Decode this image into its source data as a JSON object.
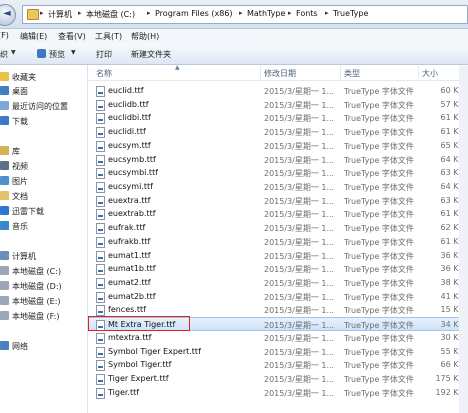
{
  "address_bar": {
    "back_glyph": "◄",
    "crumbs": [
      "计算机",
      "本地磁盘 (C:)",
      "Program Files (x86)",
      "MathType",
      "Fonts",
      "TrueType"
    ],
    "separator": "▸"
  },
  "menubar": {
    "items": [
      "(F)",
      "编辑(E)",
      "查看(V)",
      "工具(T)",
      "帮助(H)"
    ]
  },
  "commandbar": {
    "items": [
      "织",
      "预览",
      "打印",
      "新建文件夹"
    ]
  },
  "nav": {
    "items": [
      {
        "label": "收藏夹",
        "color": "#e9c24a"
      },
      {
        "label": "桌面",
        "color": "#3f7fc6"
      },
      {
        "label": "最近访问的位置",
        "color": "#7da7d6"
      },
      {
        "label": "下载",
        "color": "#3a7ac8"
      },
      {
        "label": "库",
        "color": "#d9b054"
      },
      {
        "label": "视频",
        "color": "#5f6f88"
      },
      {
        "label": "图片",
        "color": "#4e8fcf"
      },
      {
        "label": "文档",
        "color": "#e1c26a"
      },
      {
        "label": "迅雷下载",
        "color": "#2f76d1"
      },
      {
        "label": "音乐",
        "color": "#3a88c9"
      },
      {
        "label": "计算机",
        "color": "#6a8fb8"
      },
      {
        "label": "本地磁盘 (C:)",
        "color": "#9aa7b6"
      },
      {
        "label": "本地磁盘 (D:)",
        "color": "#9aa7b6"
      },
      {
        "label": "本地磁盘 (E:)",
        "color": "#9aa7b6"
      },
      {
        "label": "本地磁盘 (F:)",
        "color": "#9aa7b6"
      },
      {
        "label": "网络",
        "color": "#4a82c1"
      }
    ]
  },
  "list": {
    "headers": {
      "name": "名称",
      "date": "修改日期",
      "type": "类型",
      "size": "大小"
    },
    "rows": [
      {
        "name": "euclid.ttf",
        "date": "2015/3/星期一 1...",
        "type": "TrueType 字体文件",
        "size": "60 KB"
      },
      {
        "name": "euclidb.ttf",
        "date": "2015/3/星期一 1...",
        "type": "TrueType 字体文件",
        "size": "57 KB"
      },
      {
        "name": "euclidbi.ttf",
        "date": "2015/3/星期一 1...",
        "type": "TrueType 字体文件",
        "size": "61 KB"
      },
      {
        "name": "euclidi.ttf",
        "date": "2015/3/星期一 1...",
        "type": "TrueType 字体文件",
        "size": "61 KB"
      },
      {
        "name": "eucsym.ttf",
        "date": "2015/3/星期一 1...",
        "type": "TrueType 字体文件",
        "size": "65 KB"
      },
      {
        "name": "eucsymb.ttf",
        "date": "2015/3/星期一 1...",
        "type": "TrueType 字体文件",
        "size": "64 KB"
      },
      {
        "name": "eucsymbi.ttf",
        "date": "2015/3/星期一 1...",
        "type": "TrueType 字体文件",
        "size": "63 KB"
      },
      {
        "name": "eucsymi.ttf",
        "date": "2015/3/星期一 1...",
        "type": "TrueType 字体文件",
        "size": "64 KB"
      },
      {
        "name": "euextra.ttf",
        "date": "2015/3/星期一 1...",
        "type": "TrueType 字体文件",
        "size": "63 KB"
      },
      {
        "name": "euextrab.ttf",
        "date": "2015/3/星期一 1...",
        "type": "TrueType 字体文件",
        "size": "61 KB"
      },
      {
        "name": "eufrak.ttf",
        "date": "2015/3/星期一 1...",
        "type": "TrueType 字体文件",
        "size": "62 KB"
      },
      {
        "name": "eufrakb.ttf",
        "date": "2015/3/星期一 1...",
        "type": "TrueType 字体文件",
        "size": "61 KB"
      },
      {
        "name": "eumat1.ttf",
        "date": "2015/3/星期一 1...",
        "type": "TrueType 字体文件",
        "size": "36 KB"
      },
      {
        "name": "eumat1b.ttf",
        "date": "2015/3/星期一 1...",
        "type": "TrueType 字体文件",
        "size": "36 KB"
      },
      {
        "name": "eumat2.ttf",
        "date": "2015/3/星期一 1...",
        "type": "TrueType 字体文件",
        "size": "38 KB"
      },
      {
        "name": "eumat2b.ttf",
        "date": "2015/3/星期一 1...",
        "type": "TrueType 字体文件",
        "size": "41 KB"
      },
      {
        "name": "fences.ttf",
        "date": "2015/3/星期一 1...",
        "type": "TrueType 字体文件",
        "size": "15 KB"
      },
      {
        "name": "Mt Extra Tiger.ttf",
        "date": "2015/3/星期一 1...",
        "type": "TrueType 字体文件",
        "size": "34 KB"
      },
      {
        "name": "mtextra.ttf",
        "date": "2015/3/星期一 1...",
        "type": "TrueType 字体文件",
        "size": "30 KB"
      },
      {
        "name": "Symbol Tiger Expert.ttf",
        "date": "2015/3/星期一 1...",
        "type": "TrueType 字体文件",
        "size": "55 KB"
      },
      {
        "name": "Symbol Tiger.ttf",
        "date": "2015/3/星期一 1...",
        "type": "TrueType 字体文件",
        "size": "66 KB"
      },
      {
        "name": "Tiger Expert.ttf",
        "date": "2015/3/星期一 1...",
        "type": "TrueType 字体文件",
        "size": "175 KB"
      },
      {
        "name": "Tiger.ttf",
        "date": "2015/3/星期一 1...",
        "type": "TrueType 字体文件",
        "size": "192 KB"
      }
    ],
    "selected_index": 17
  },
  "colors": {
    "highlight_box": "#e0221c",
    "selection": "#cfe3fb"
  }
}
